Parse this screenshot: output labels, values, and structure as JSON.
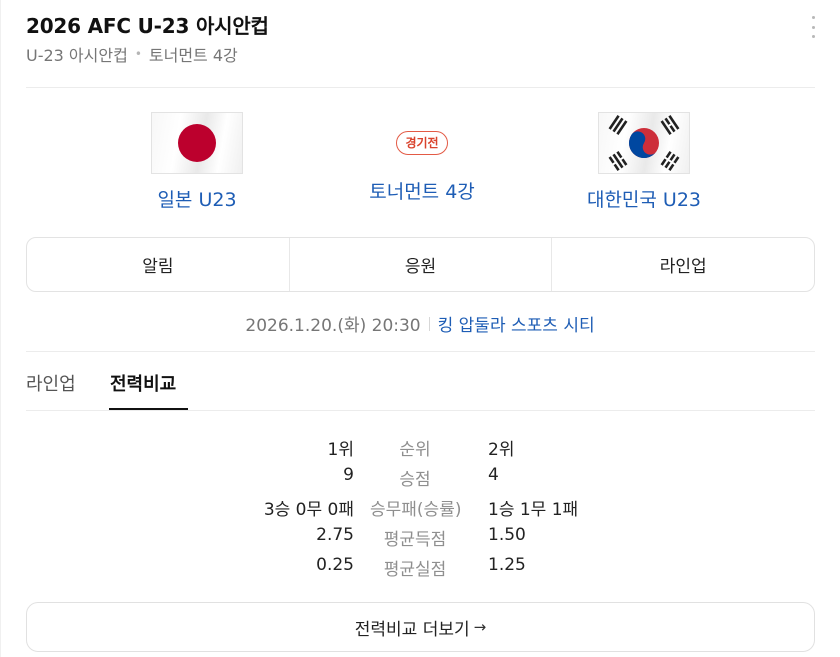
{
  "header": {
    "title": "2026 AFC U-23 아시안컵",
    "breadcrumb": [
      "U-23 아시안컵",
      "토너먼트 4강"
    ]
  },
  "match": {
    "status": "경기전",
    "round": "토너먼트 4강",
    "home_team": "일본 U23",
    "away_team": "대한민국 U23",
    "home_flag_icon": "japan-flag-icon",
    "away_flag_icon": "korea-flag-icon",
    "datetime": "2026.1.20.(화) 20:30",
    "venue": "킹 압둘라 스포츠 시티"
  },
  "actions": [
    "알림",
    "응원",
    "라인업"
  ],
  "tabs": [
    {
      "label": "라인업",
      "active": false
    },
    {
      "label": "전력비교",
      "active": true
    }
  ],
  "stats": [
    {
      "label": "순위",
      "home": "1위",
      "away": "2위"
    },
    {
      "label": "승점",
      "home": "9",
      "away": "4"
    },
    {
      "label": "승무패(승률)",
      "home": "3승 0무 0패",
      "away": "1승 1무 1패"
    },
    {
      "label": "평균득점",
      "home": "2.75",
      "away": "1.50"
    },
    {
      "label": "평균실점",
      "home": "0.25",
      "away": "1.25"
    }
  ],
  "more_button_label": "전력비교 더보기",
  "colors": {
    "link": "#1e5db5",
    "status": "#d9432d",
    "japan_red": "#bc002d",
    "korea_red": "#cd2e3a",
    "korea_blue": "#0047a0"
  }
}
